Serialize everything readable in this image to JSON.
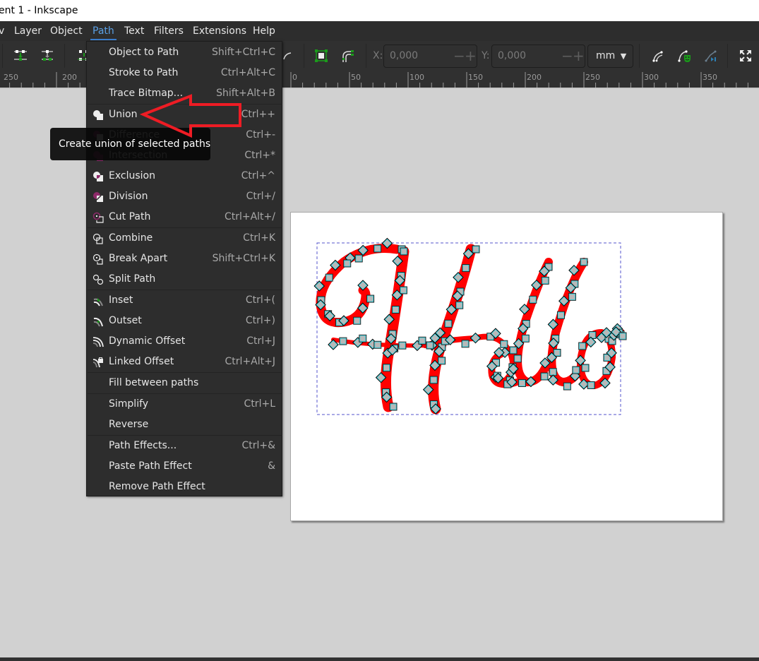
{
  "window": {
    "title": "ent 1 - Inkscape"
  },
  "menubar": {
    "items": [
      {
        "label": "v"
      },
      {
        "label": "Layer"
      },
      {
        "label": "Object"
      },
      {
        "label": "Path",
        "active": true
      },
      {
        "label": "Text"
      },
      {
        "label": "Filters"
      },
      {
        "label": "Extensions"
      },
      {
        "label": "Help"
      }
    ]
  },
  "toolbar": {
    "x_label": "X:",
    "x_value": "0,000",
    "y_label": "Y:",
    "y_value": "0,000",
    "minus": "−",
    "plus": "+",
    "unit": "mm",
    "unit_arrow": "▼",
    "icons": [
      "align-distribute-icon",
      "align-distribute-icon",
      "align-distribute-icon",
      "bezier-tool-icon",
      "snap-bbox-icon",
      "snap-path-icon",
      "node-smooth-icon",
      "node-mask-icon",
      "node-cusp-icon",
      "zoom-fit-icon"
    ]
  },
  "ruler": {
    "labels": [
      "250",
      "200",
      "0",
      "50",
      "100",
      "150",
      "200",
      "250",
      "300",
      "350"
    ]
  },
  "path_menu": {
    "items": [
      {
        "label": "Object to Path",
        "shortcut": "Shift+Ctrl+C",
        "icon": ""
      },
      {
        "label": "Stroke to Path",
        "shortcut": "Ctrl+Alt+C",
        "icon": ""
      },
      {
        "label": "Trace Bitmap...",
        "shortcut": "Shift+Alt+B",
        "icon": ""
      },
      {
        "label": "Union",
        "shortcut": "Ctrl++",
        "icon": "union-icon"
      },
      {
        "label": "Difference",
        "shortcut": "Ctrl+-",
        "icon": "difference-icon"
      },
      {
        "label": "Intersection",
        "shortcut": "Ctrl+*",
        "icon": "intersection-icon"
      },
      {
        "label": "Exclusion",
        "shortcut": "Ctrl+^",
        "icon": "exclusion-icon"
      },
      {
        "label": "Division",
        "shortcut": "Ctrl+/",
        "icon": "division-icon"
      },
      {
        "label": "Cut Path",
        "shortcut": "Ctrl+Alt+/",
        "icon": "cut-path-icon"
      },
      {
        "label": "Combine",
        "shortcut": "Ctrl+K",
        "icon": "combine-icon"
      },
      {
        "label": "Break Apart",
        "shortcut": "Shift+Ctrl+K",
        "icon": "break-apart-icon"
      },
      {
        "label": "Split Path",
        "shortcut": "",
        "icon": "split-path-icon"
      },
      {
        "label": "Inset",
        "shortcut": "Ctrl+(",
        "icon": "inset-icon"
      },
      {
        "label": "Outset",
        "shortcut": "Ctrl+)",
        "icon": "outset-icon"
      },
      {
        "label": "Dynamic Offset",
        "shortcut": "Ctrl+J",
        "icon": "dynamic-offset-icon"
      },
      {
        "label": "Linked Offset",
        "shortcut": "Ctrl+Alt+J",
        "icon": "linked-offset-icon"
      },
      {
        "label": "Fill between paths",
        "shortcut": "",
        "icon": ""
      },
      {
        "label": "Simplify",
        "shortcut": "Ctrl+L",
        "icon": ""
      },
      {
        "label": "Reverse",
        "shortcut": "",
        "icon": ""
      },
      {
        "label": "Path Effects...",
        "shortcut": "Ctrl+&",
        "icon": ""
      },
      {
        "label": "Paste Path Effect",
        "shortcut": "&",
        "icon": ""
      },
      {
        "label": "Remove Path Effect",
        "shortcut": "",
        "icon": ""
      }
    ]
  },
  "tooltip": {
    "text": "Create union of selected paths"
  },
  "canvas": {
    "artwork_text": "Hello",
    "artwork_fill": "#ff0000",
    "node_fill": "#b8b8b8",
    "bbox_color": "#5555cc",
    "annotation_arrow_color": "#ee1c24"
  }
}
